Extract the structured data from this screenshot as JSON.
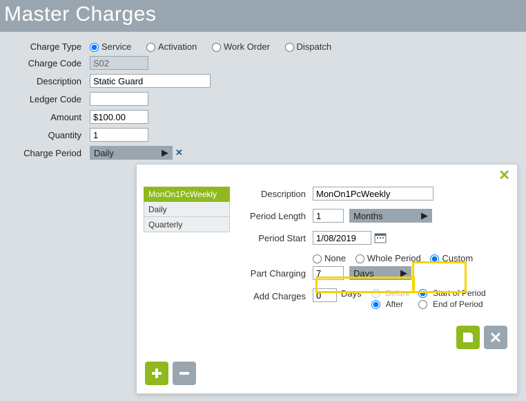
{
  "title": "Master Charges",
  "form": {
    "charge_type_label": "Charge Type",
    "charge_type_options": {
      "service": "Service",
      "activation": "Activation",
      "work_order": "Work Order",
      "dispatch": "Dispatch"
    },
    "charge_code_label": "Charge Code",
    "charge_code_value": "S02",
    "description_label": "Description",
    "description_value": "Static Guard",
    "ledger_label": "Ledger Code",
    "ledger_value": "",
    "amount_label": "Amount",
    "amount_value": "$100.00",
    "quantity_label": "Quantity",
    "quantity_value": "1",
    "charge_period_label": "Charge Period",
    "charge_period_value": "Daily"
  },
  "panel": {
    "periods": [
      "MonOn1PcWeekly",
      "Daily",
      "Quarterly"
    ],
    "selected_period_index": 0,
    "description_label": "Description",
    "description_value": "MonOn1PcWeekly",
    "period_length_label": "Period Length",
    "period_length_value": "1",
    "period_length_unit": "Months",
    "period_start_label": "Period Start",
    "period_start_value": "1/08/2019",
    "part_charging_label": "Part Charging",
    "part_options": {
      "none": "None",
      "whole": "Whole Period",
      "custom": "Custom"
    },
    "part_value": "7",
    "part_unit": "Days",
    "add_charges_label": "Add Charges",
    "add_charges_value": "0",
    "add_charges_unit": "Days",
    "timing_before": "Before",
    "timing_after": "After",
    "timing_start": "Start of Period",
    "timing_end": "End of Period"
  }
}
